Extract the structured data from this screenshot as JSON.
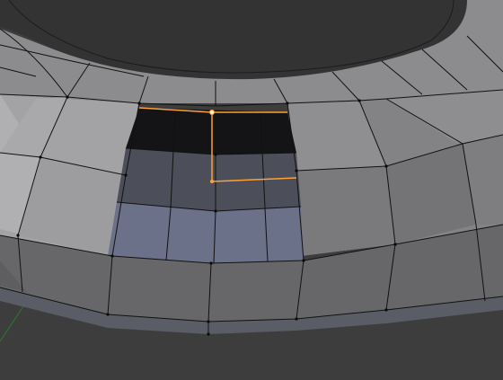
{
  "editor": {
    "type": "3d-viewport",
    "mode": "edit-mode",
    "shading": "solid",
    "view": "user-perspective"
  },
  "scene": {
    "object": "torus",
    "selection": "edge-loop",
    "selected_vertex_count": 2,
    "colors": {
      "background": "#3d3d3d",
      "selection": "#ffa233",
      "grid_axis": "#2f7a2f"
    }
  }
}
